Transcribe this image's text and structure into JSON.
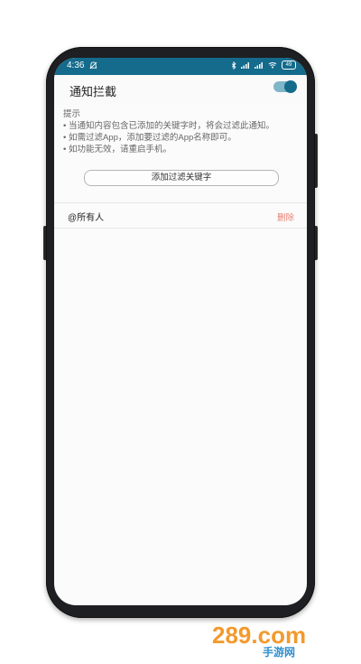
{
  "statusbar": {
    "time": "4:36",
    "battery": "49"
  },
  "header": {
    "title": "通知拦截",
    "toggle_on": true
  },
  "hint": {
    "heading": "提示",
    "lines": [
      "• 当通知内容包含已添加的关键字时，将会过滤此通知。",
      "• 如需过滤App，添加要过滤的App名称即可。",
      "• 如功能无效，请重启手机。"
    ]
  },
  "add_button": {
    "label": "添加过滤关键字"
  },
  "keywords": [
    {
      "label": "@所有人",
      "delete_label": "删除"
    }
  ],
  "watermark": {
    "text": "289.com",
    "subtext": "手游网"
  },
  "colors": {
    "accent": "#146b8c",
    "delete": "#e87e73"
  }
}
